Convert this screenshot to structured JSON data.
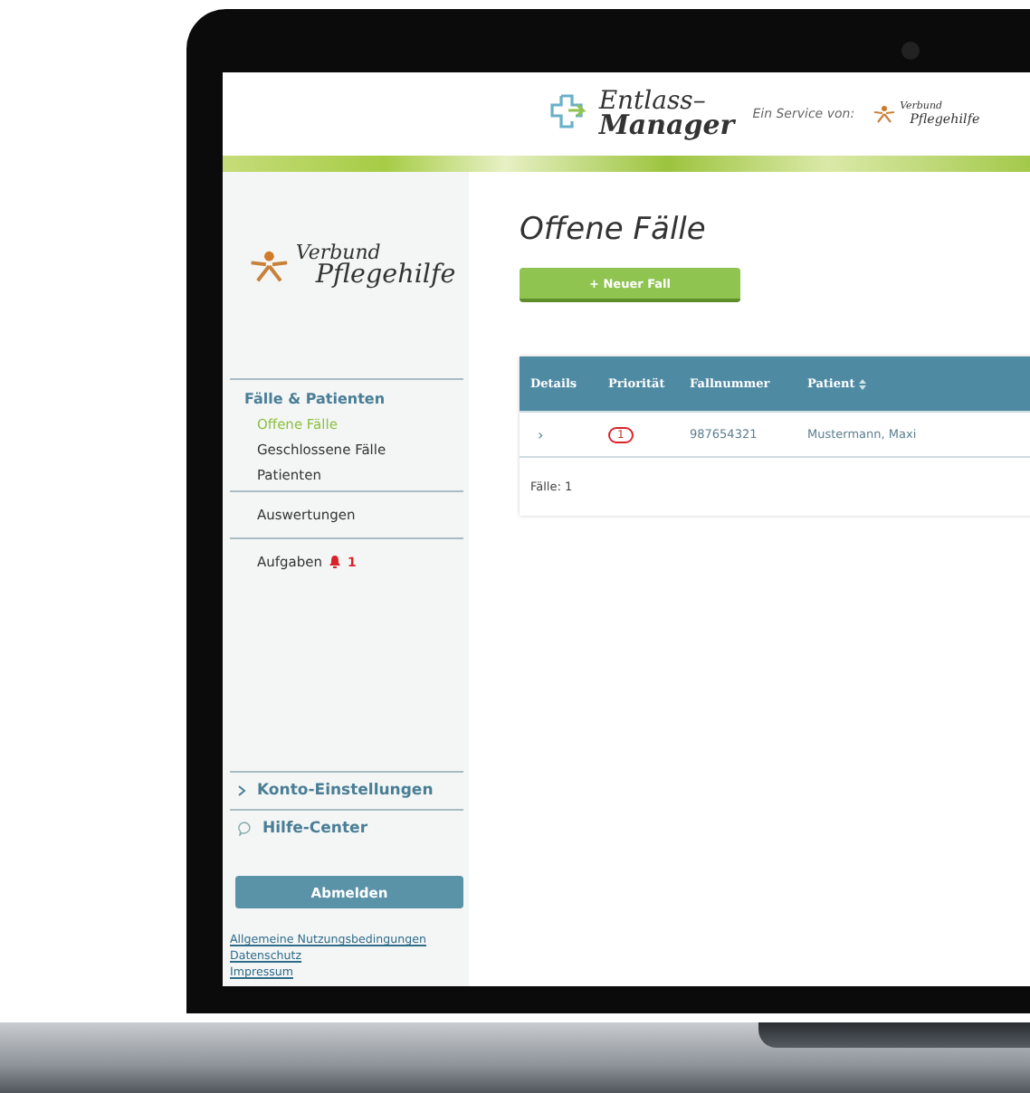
{
  "header": {
    "app_logo": [
      "Entlass–",
      "Manager"
    ],
    "service_label": "Ein Service von:",
    "partner_logo": [
      "Verbund",
      "Pflegehilfe"
    ]
  },
  "sidebar": {
    "logo": [
      "Verbund",
      "Pflegehilfe"
    ],
    "nav_heading": "Fälle & Patienten",
    "nav_items": [
      {
        "label": "Offene Fälle",
        "selected": true
      },
      {
        "label": "Geschlossene Fälle",
        "selected": false
      },
      {
        "label": "Patienten",
        "selected": false
      }
    ],
    "reports": "Auswertungen",
    "tasks": {
      "label": "Aufgaben",
      "count": "1"
    },
    "account": "Konto-Einstellungen",
    "help": "Hilfe-Center",
    "logout": "Abmelden",
    "links": [
      "Allgemeine Nutzungsbedingungen",
      "Datenschutz",
      "Impressum"
    ]
  },
  "main": {
    "title": "Offene Fälle",
    "new_button": "+ Neuer Fall",
    "table": {
      "columns": [
        {
          "label": "Details",
          "sortable": false
        },
        {
          "label": "Priorität",
          "sortable": false
        },
        {
          "label": "Fallnummer",
          "sortable": false
        },
        {
          "label": "Patient",
          "sortable": true
        }
      ],
      "rows": [
        {
          "expand": "›",
          "priority": "1",
          "case_number": "987654321",
          "patient": "Mustermann, Maxi"
        }
      ],
      "footer": "Fälle: 1"
    }
  }
}
